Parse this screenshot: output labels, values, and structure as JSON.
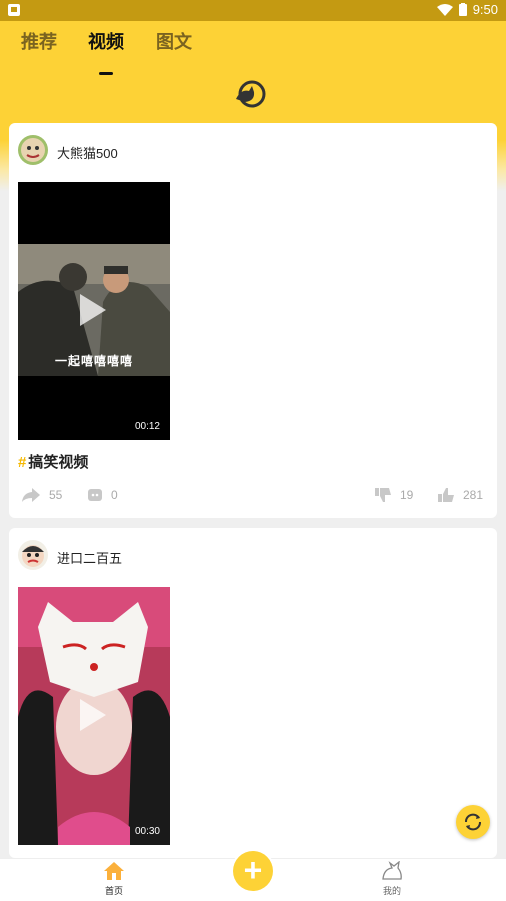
{
  "status_bar": {
    "time": "9:50"
  },
  "tabs": [
    {
      "label": "推荐",
      "active": false
    },
    {
      "label": "视频",
      "active": true
    },
    {
      "label": "图文",
      "active": false
    }
  ],
  "posts": [
    {
      "username": "大熊猫500",
      "video_caption": "一起嘻嘻嘻嘻",
      "duration": "00:12",
      "hashtag_symbol": "#",
      "hashtag": "搞笑视频",
      "shares": "55",
      "comments": "0",
      "dislikes": "19",
      "likes": "281"
    },
    {
      "username": "进口二百五",
      "duration": "00:30"
    }
  ],
  "bottom_nav": [
    {
      "label": "首页",
      "icon": "home-icon",
      "active": true
    },
    {
      "label": "我的",
      "icon": "profile-icon",
      "active": false
    }
  ],
  "colors": {
    "brand_yellow": "#fdd236",
    "status_bar": "#c49a12"
  }
}
